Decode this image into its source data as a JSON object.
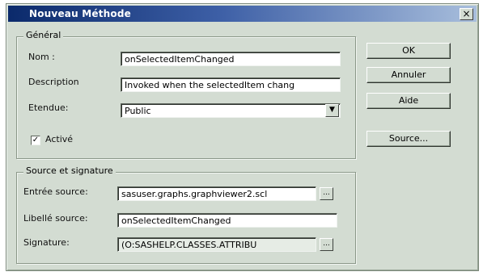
{
  "window": {
    "title": "Nouveau Méthode",
    "close_glyph": "×"
  },
  "general": {
    "group_title": "Général",
    "nom_label": "Nom :",
    "nom_value": "onSelectedItemChanged",
    "description_label": "Description",
    "description_value": "Invoked when the selectedItem chang",
    "etendue_label": "Etendue:",
    "etendue_value": "Public",
    "active_label": "Activé",
    "active_checked": true,
    "checkmark": "✓"
  },
  "source_signature": {
    "group_title": "Source et signature",
    "entree_label": "Entrée source:",
    "entree_value": "sasuser.graphs.graphviewer2.scl",
    "libelle_label": "Libellé source:",
    "libelle_value": "onSelectedItemChanged",
    "signature_label": "Signature:",
    "signature_value": "(O:SASHELP.CLASSES.ATTRIBU",
    "ellipsis_glyph": "..."
  },
  "buttons": {
    "ok": "OK",
    "annuler": "Annuler",
    "aide": "Aide",
    "source": "Source..."
  },
  "icons": {
    "dropdown": "chevron-down-icon",
    "close": "close-icon",
    "browse": "ellipsis-icon"
  },
  "colors": {
    "dialog_bg": "#d3dcd2",
    "titlebar_start": "#0b2a6b",
    "titlebar_end": "#a8bedc"
  }
}
